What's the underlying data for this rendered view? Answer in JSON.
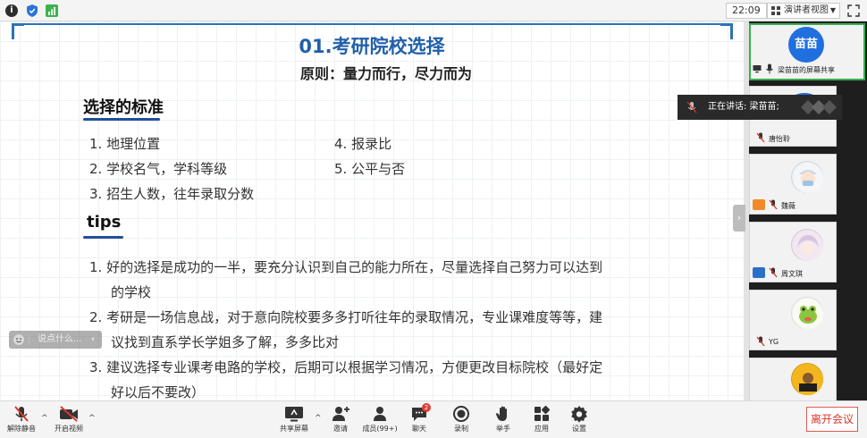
{
  "topbar": {
    "clock": "22:09",
    "view_button": "演讲者视图"
  },
  "slide": {
    "title": "01.考研院校选择",
    "subtitle": "原则：量力而行，尽力而为",
    "criteria_heading": "选择的标准",
    "criteria_left": [
      "1.  地理位置",
      "2.  学校名气，学科等级",
      "3.  招生人数，往年录取分数"
    ],
    "criteria_right": [
      "4.  报录比",
      "5.  公平与否"
    ],
    "tips_heading": "tips",
    "tips_lines": [
      "1.  好的选择是成功的一半，要充分认识到自己的能力所在，尽量选择自己努力可以达到",
      "的学校",
      "2.  考研是一场信息战，对于意向院校要多多打听往年的录取情况，专业课难度等等，建",
      "议找到直系学长学姐多了解，多多比对",
      "3.  建议选择专业课考电路的学校，后期可以根据学习情况，方便更改目标院校（最好定",
      "好以后不要改）"
    ]
  },
  "chat_bubble": {
    "placeholder": "说点什么..."
  },
  "speaking": {
    "text": "正在讲话: 梁苗苗;"
  },
  "participants": {
    "host_avatar_text": "苗苗",
    "host_label": "梁苗苗的屏幕共享",
    "names": [
      "唐怡聆",
      "魏薇",
      "周文琪",
      "YG"
    ]
  },
  "toolbar": {
    "mute": "解除静音",
    "video": "开启视频",
    "share": "共享屏幕",
    "invite": "邀请",
    "members": "成员(99+)",
    "chat": "聊天",
    "chat_badge": "2",
    "record": "录制",
    "raise_hand": "举手",
    "apps": "应用",
    "settings": "设置",
    "leave": "离开会议"
  },
  "colors": {
    "title_blue": "#2160a8",
    "underline_blue": "#1e4f9a",
    "leave_red": "#d9362b",
    "active_green": "#35b050"
  }
}
